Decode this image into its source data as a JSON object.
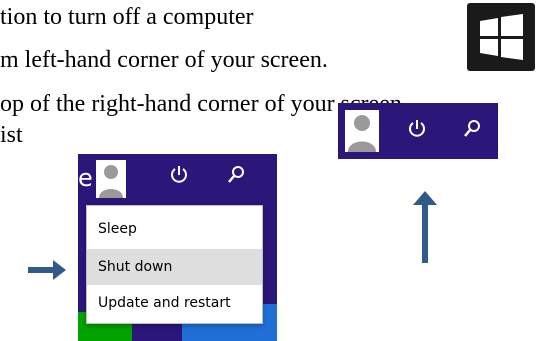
{
  "document": {
    "lines": [
      "tion to turn off a computer",
      "m left-hand corner of your screen.",
      "op of the right-hand corner of your screen.",
      "ist"
    ]
  },
  "start_screen_crop": {
    "edge_letter": "e",
    "power_menu": {
      "items": [
        {
          "label": "Sleep"
        },
        {
          "label": "Shut down"
        },
        {
          "label": "Update and restart"
        }
      ],
      "highlighted": "Shut down"
    }
  },
  "colors": {
    "start_background": "#2b167a",
    "tile_green": "#00a300",
    "tile_blue": "#1f6fd6",
    "arrow": "#2f5a8a",
    "menu_highlight": "#dedede",
    "windows_tile": "#1a1a1a"
  },
  "icons": [
    "windows-logo-icon",
    "user-avatar-icon",
    "power-icon",
    "search-icon",
    "arrow-right-icon",
    "arrow-up-icon"
  ]
}
